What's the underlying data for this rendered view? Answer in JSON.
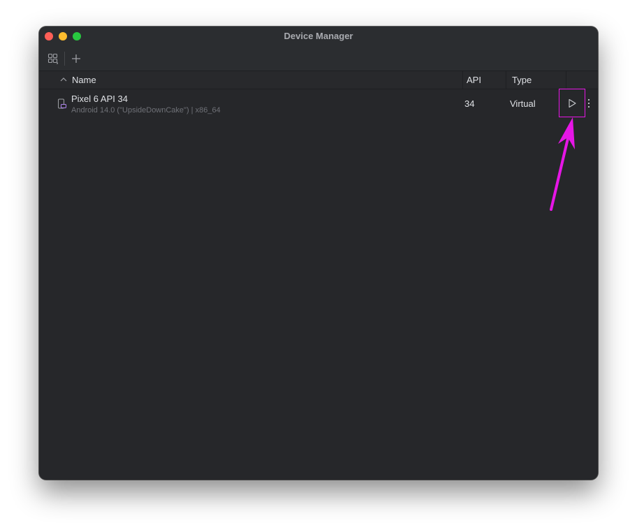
{
  "window": {
    "title": "Device Manager"
  },
  "toolbar": {
    "icons": [
      "device-grid-icon",
      "add-icon"
    ]
  },
  "table": {
    "columns": {
      "name": "Name",
      "api": "API",
      "type": "Type"
    },
    "rows": [
      {
        "name": "Pixel 6 API 34",
        "details": "Android 14.0 (\"UpsideDownCake\") | x86_64",
        "api": "34",
        "type": "Virtual"
      }
    ]
  },
  "colors": {
    "annotation": "#e616e6",
    "window_bg": "#2b2d30",
    "content_bg": "#26272a"
  }
}
